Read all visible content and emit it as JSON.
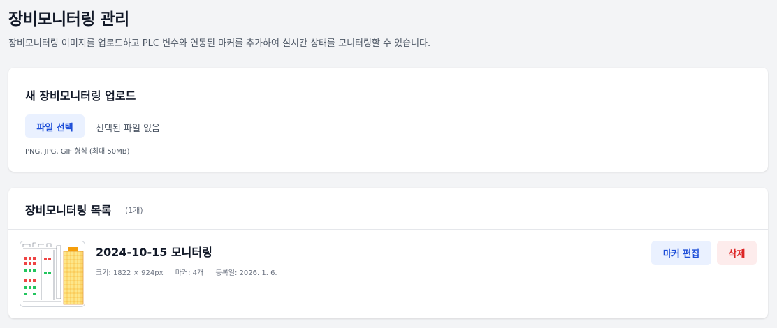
{
  "page": {
    "title": "장비모니터링 관리",
    "description": "장비모니터링 이미지를 업로드하고 PLC 변수와 연동된 마커를 추가하여 실시간 상태를 모니터링할 수 있습니다."
  },
  "upload": {
    "title": "새 장비모니터링 업로드",
    "file_button": "파일 선택",
    "file_status": "선택된 파일 없음",
    "hint": "PNG, JPG, GIF 형식 (최대 50MB)"
  },
  "list": {
    "title": "장비모니터링 목록",
    "count": "(1개)",
    "items": [
      {
        "name": "2024-10-15 모니터링",
        "size": "크기: 1822 × 924px",
        "markers": "마커: 4개",
        "registered": "등록일: 2026. 1. 6.",
        "edit_label": "마커 편집",
        "delete_label": "삭제"
      }
    ]
  },
  "colors": {
    "primary_text": "#1d4ed8",
    "primary_bg": "#eaf1ff",
    "danger_text": "#dc2626",
    "danger_bg": "#fdecec"
  }
}
